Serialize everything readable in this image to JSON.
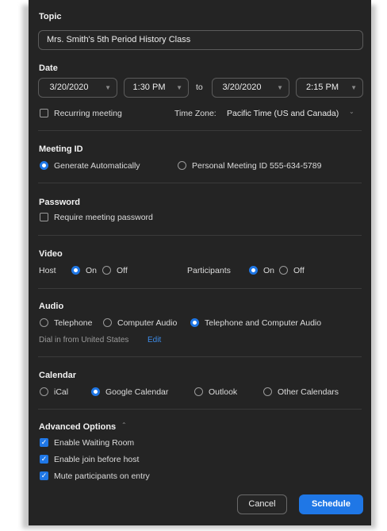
{
  "topic": {
    "label": "Topic",
    "value": "Mrs. Smith's 5th Period History Class"
  },
  "date": {
    "label": "Date",
    "start_date": "3/20/2020",
    "start_time": "1:30 PM",
    "to_label": "to",
    "end_date": "3/20/2020",
    "end_time": "2:15 PM",
    "recurring_label": "Recurring meeting",
    "recurring_checked": false,
    "timezone_label": "Time Zone:",
    "timezone_value": "Pacific Time (US and Canada)"
  },
  "meeting_id": {
    "label": "Meeting ID",
    "options": [
      "Generate Automatically",
      "Personal Meeting ID 555-634-5789"
    ],
    "selected": "Generate Automatically"
  },
  "password": {
    "label": "Password",
    "require_label": "Require meeting password",
    "checked": false
  },
  "video": {
    "label": "Video",
    "host_label": "Host",
    "participants_label": "Participants",
    "on_label": "On",
    "off_label": "Off",
    "host": "On",
    "participants": "On"
  },
  "audio": {
    "label": "Audio",
    "options": [
      "Telephone",
      "Computer Audio",
      "Telephone and Computer Audio"
    ],
    "selected": "Telephone and Computer Audio",
    "dial_in_text": "Dial in from United States",
    "edit_label": "Edit"
  },
  "calendar": {
    "label": "Calendar",
    "options": [
      "iCal",
      "Google Calendar",
      "Outlook",
      "Other Calendars"
    ],
    "selected": "Google Calendar"
  },
  "advanced": {
    "label": "Advanced Options",
    "options": [
      {
        "label": "Enable Waiting Room",
        "checked": true
      },
      {
        "label": "Enable join before host",
        "checked": true
      },
      {
        "label": "Mute participants on entry",
        "checked": true
      }
    ]
  },
  "buttons": {
    "cancel": "Cancel",
    "schedule": "Schedule"
  },
  "colors": {
    "background": "#242424",
    "accent": "#1f77e6",
    "link": "#3d8ce8"
  }
}
